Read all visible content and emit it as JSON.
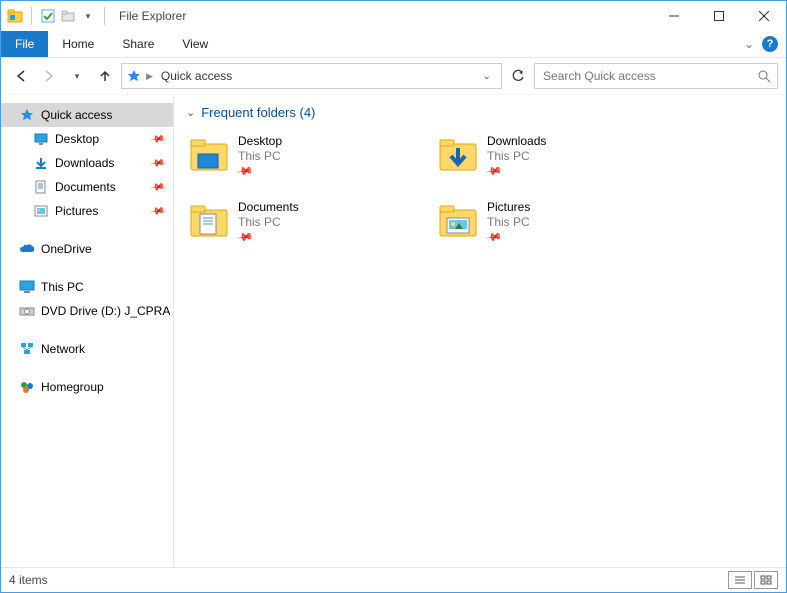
{
  "title": "File Explorer",
  "ribbon": {
    "file": "File",
    "home": "Home",
    "share": "Share",
    "view": "View"
  },
  "nav": {
    "address_label": "Quick access"
  },
  "search": {
    "placeholder": "Search Quick access"
  },
  "sidebar": {
    "quick_access": "Quick access",
    "items": [
      {
        "label": "Desktop"
      },
      {
        "label": "Downloads"
      },
      {
        "label": "Documents"
      },
      {
        "label": "Pictures"
      }
    ],
    "onedrive": "OneDrive",
    "thispc": "This PC",
    "dvd": "DVD Drive (D:) J_CPRA",
    "network": "Network",
    "homegroup": "Homegroup"
  },
  "section": {
    "title": "Frequent folders (4)"
  },
  "folders": [
    {
      "name": "Desktop",
      "loc": "This PC"
    },
    {
      "name": "Downloads",
      "loc": "This PC"
    },
    {
      "name": "Documents",
      "loc": "This PC"
    },
    {
      "name": "Pictures",
      "loc": "This PC"
    }
  ],
  "status": {
    "count": "4 items"
  }
}
